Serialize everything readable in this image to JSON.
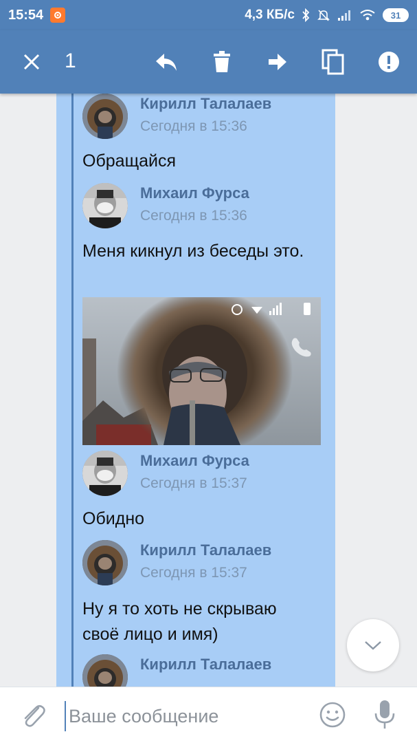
{
  "status_bar": {
    "time": "15:54",
    "network_speed": "4,3 КБ/с",
    "battery": "31",
    "icons": [
      "notification-app-icon",
      "bluetooth-icon",
      "mute-icon",
      "signal-icon",
      "wifi-icon",
      "battery-icon"
    ]
  },
  "toolbar": {
    "selected_count": "1",
    "icons": [
      "close-icon",
      "reply-icon",
      "delete-icon",
      "forward-icon",
      "copy-icon",
      "report-icon"
    ]
  },
  "messages": [
    {
      "author": "Кирилл Талалаев",
      "time": "Сегодня в 15:36",
      "text": "Обращайся",
      "avatar": "hood-avatar"
    },
    {
      "author": "Михаил Фурса",
      "time": "Сегодня в 15:36",
      "text": "Меня кикнул из беседы это.",
      "avatar": "mask-avatar",
      "attachment": "photo"
    },
    {
      "author": "Михаил Фурса",
      "time": "Сегодня в 15:37",
      "text": "Обидно",
      "avatar": "mask-avatar"
    },
    {
      "author": "Кирилл Талалаев",
      "time": "Сегодня в 15:37",
      "text": "Ну я то хоть не скрываю своё лицо и имя)",
      "avatar": "hood-avatar"
    },
    {
      "author": "Кирилл Талалаев",
      "time": "",
      "text": "",
      "avatar": "hood-avatar"
    }
  ],
  "composer": {
    "placeholder": "Ваше сообщение",
    "icons": [
      "attach-icon",
      "emoji-icon",
      "microphone-icon"
    ]
  },
  "colors": {
    "header": "#5181b8",
    "selection": "#a8cdf6",
    "author": "#4a6d99",
    "timestamp": "#7d96b3"
  }
}
